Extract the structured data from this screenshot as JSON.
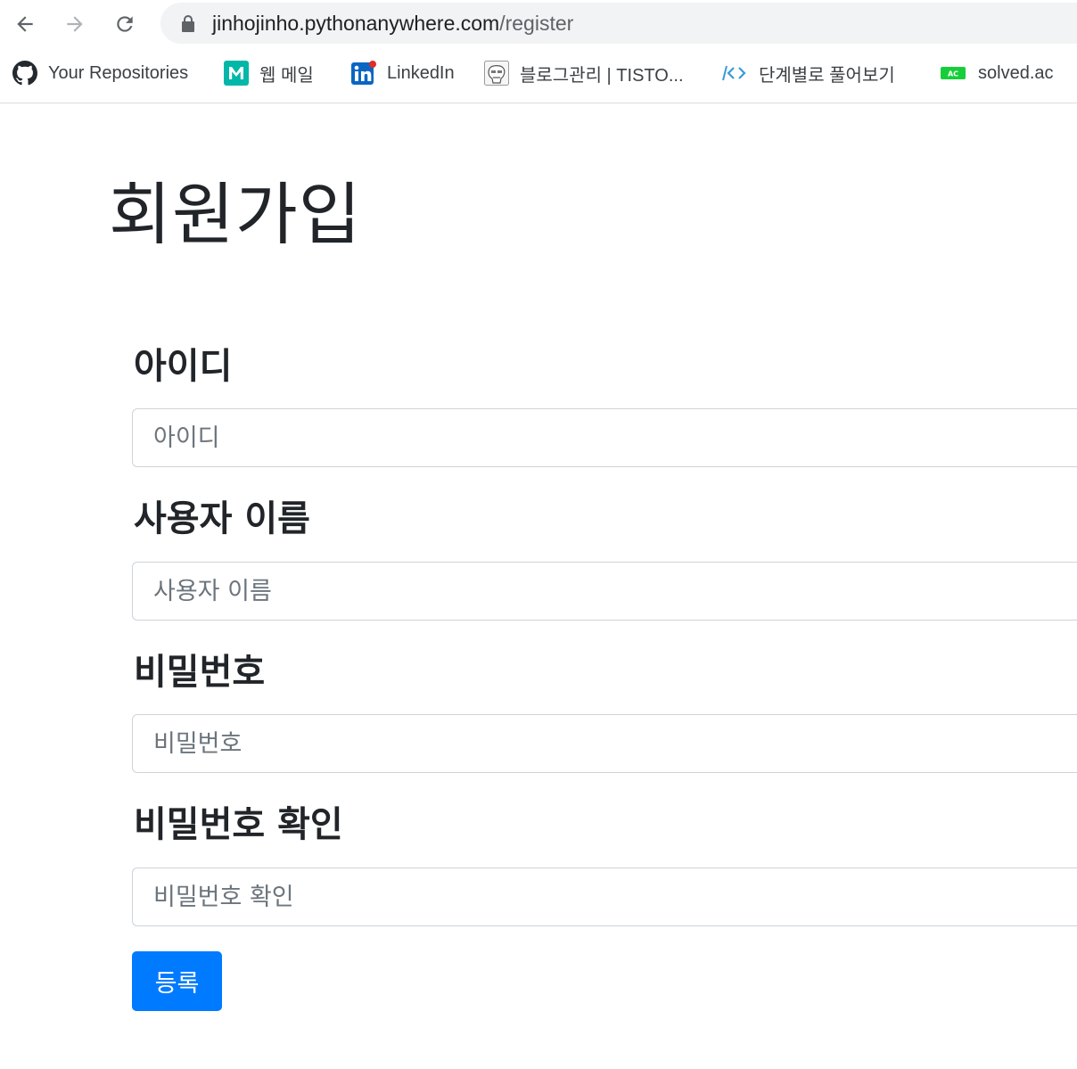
{
  "browser": {
    "url_host": "jinhojinho.pythonanywhere.com",
    "url_path": "/register",
    "bookmarks": [
      {
        "label": "Your Repositories",
        "icon": "github-icon"
      },
      {
        "label": "웹 메일",
        "icon": "mail-m-icon"
      },
      {
        "label": "LinkedIn",
        "icon": "linkedin-icon"
      },
      {
        "label": "블로그관리 | TISTO...",
        "icon": "tistory-avatar-icon"
      },
      {
        "label": "단계별로 풀어보기",
        "icon": "code-brackets-icon"
      },
      {
        "label": "solved.ac",
        "icon": "solved-ac-icon"
      }
    ]
  },
  "page": {
    "title": "회원가입",
    "fields": [
      {
        "label": "아이디",
        "placeholder": "아이디",
        "value": ""
      },
      {
        "label": "사용자 이름",
        "placeholder": "사용자 이름",
        "value": ""
      },
      {
        "label": "비밀번호",
        "placeholder": "비밀번호",
        "value": ""
      },
      {
        "label": "비밀번호 확인",
        "placeholder": "비밀번호 확인",
        "value": ""
      }
    ],
    "submit_label": "등록"
  },
  "colors": {
    "primary_button": "#007bff",
    "input_border": "#ced4da",
    "text": "#212529",
    "placeholder": "#6c757d",
    "omnibox_bg": "#f1f3f4"
  }
}
